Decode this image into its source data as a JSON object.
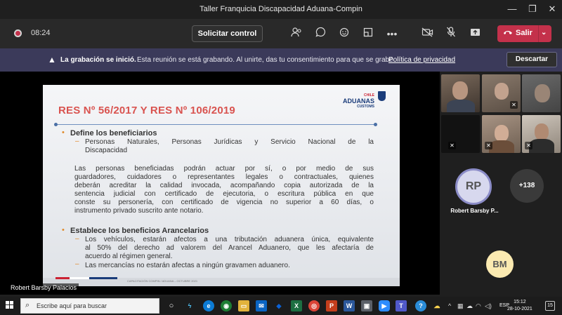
{
  "window": {
    "title": "Taller Franquicia Discapacidad Aduana-Compin"
  },
  "toolbar": {
    "timer": "08:24",
    "request_control": "Solicitar control",
    "leave": "Salir"
  },
  "banner": {
    "bold": "La grabación se inició.",
    "text": "Esta reunión se está grabando. Al unirte, das tu consentimiento para que se grabe.",
    "link": "Política de privacidad",
    "dismiss": "Descartar"
  },
  "slide": {
    "title": "RES Nº 56/2017 Y RES Nº 106/2019",
    "logo_top": "CHILE",
    "logo_main": "ADUANAS",
    "logo_bottom": "CUSTOMS",
    "section1_heading": "Define los beneficiarios",
    "section1_item_line1": "Personas Naturales, Personas Jurídicas y Servicio Nacional de la",
    "section1_item_line2": "Discapacidad",
    "para_lines": [
      "Las personas beneficiadas podrán actuar por sí, o por medio de sus",
      "guardadores, cuidadores o representantes legales o contractuales, quienes",
      "deberán acreditar la calidad invocada, acompañando copia autorizada de la",
      "sentencia judicial con certificado de ejecutoria, o escritura pública en que",
      "conste su personería, con certificado de vigencia no superior a 60 días, o",
      "instrumento privado suscrito ante notario."
    ],
    "section2_heading": "Establece los beneficios Arancelarios",
    "section2_item1_lines": [
      "Los vehículos, estarán afectos a una tributación aduanera única, equivalente",
      "al 50% del derecho ad valorem del Arancel Aduanero, que les afectaría de",
      "acuerdo al régimen general."
    ],
    "section2_item2": "Las mercancías no estarán afectas a ningún gravamen aduanero.",
    "footer": "CAPACITACIÓN COMPIN / ADUANA – OCTUBRE 2021"
  },
  "presenter": {
    "name": "Robert Barsby Palacios"
  },
  "participants": {
    "rp_initials": "RP",
    "rp_name": "Robert Barsby P...",
    "more_count": "+138",
    "bm_initials": "BM"
  },
  "taskbar": {
    "search_placeholder": "Escribe aquí para buscar",
    "language": "ESP",
    "time": "15:12",
    "date": "28-10-2021",
    "notification_count": "15"
  },
  "colors": {
    "leave_red": "#c4314b",
    "banner_bg": "#3b3a5a",
    "slide_title_red": "#d9534f",
    "bullet_orange": "#e08a2b"
  }
}
